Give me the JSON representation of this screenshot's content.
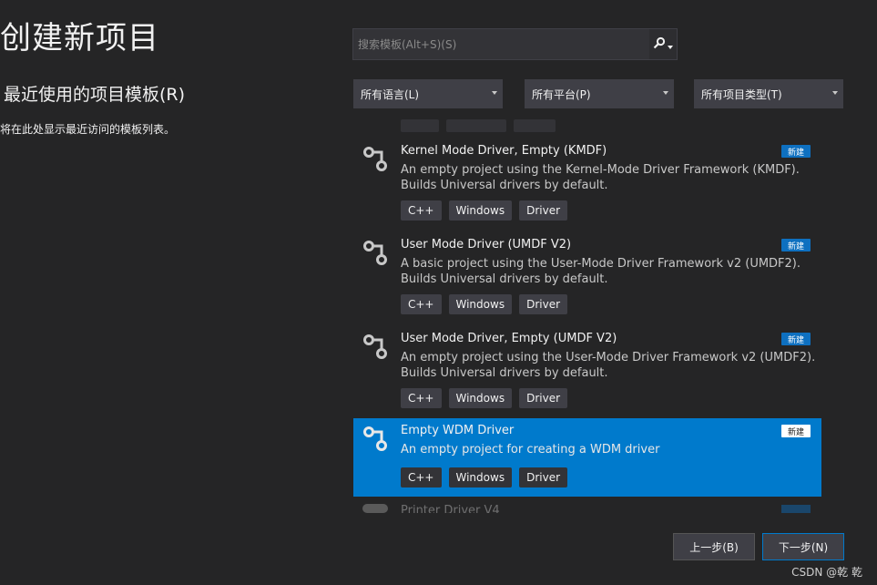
{
  "page": {
    "title": "创建新项目",
    "recent_heading": "最近使用的项目模板(R)",
    "recent_empty_text": "将在此处显示最近访问的模板列表。"
  },
  "search": {
    "placeholder": "搜索模板(Alt+S)(S)",
    "icon": "search-icon"
  },
  "filters": [
    {
      "label": "所有语言(L)"
    },
    {
      "label": "所有平台(P)"
    },
    {
      "label": "所有项目类型(T)"
    }
  ],
  "templates": [
    {
      "name": "Kernel Mode Driver, Empty (KMDF)",
      "description": [
        "An empty project using the Kernel-Mode Driver Framework (KMDF).",
        "Builds Universal drivers by default."
      ],
      "tags": [
        "C++",
        "Windows",
        "Driver"
      ],
      "badge": "新建",
      "selected": false
    },
    {
      "name": "User Mode Driver (UMDF V2)",
      "description": [
        "A basic project using the User-Mode Driver Framework v2 (UMDF2).",
        "Builds Universal drivers by default."
      ],
      "tags": [
        "C++",
        "Windows",
        "Driver"
      ],
      "badge": "新建",
      "selected": false
    },
    {
      "name": "User Mode Driver, Empty (UMDF V2)",
      "description": [
        "An empty project using the User-Mode Driver Framework v2 (UMDF2).",
        "Builds Universal drivers by default."
      ],
      "tags": [
        "C++",
        "Windows",
        "Driver"
      ],
      "badge": "新建",
      "selected": false
    },
    {
      "name": "Empty WDM Driver",
      "description": [
        "An empty project for creating a WDM driver"
      ],
      "tags": [
        "C++",
        "Windows",
        "Driver"
      ],
      "badge": "新建",
      "selected": true
    }
  ],
  "partial_template": {
    "name": "Printer Driver V4"
  },
  "buttons": {
    "back": "上一步(B)",
    "next": "下一步(N)"
  },
  "watermark": "CSDN @乾 乾",
  "colors": {
    "background": "#252526",
    "selected": "#007acc",
    "badge": "#0e70c0",
    "tag": "#3f3f46"
  }
}
